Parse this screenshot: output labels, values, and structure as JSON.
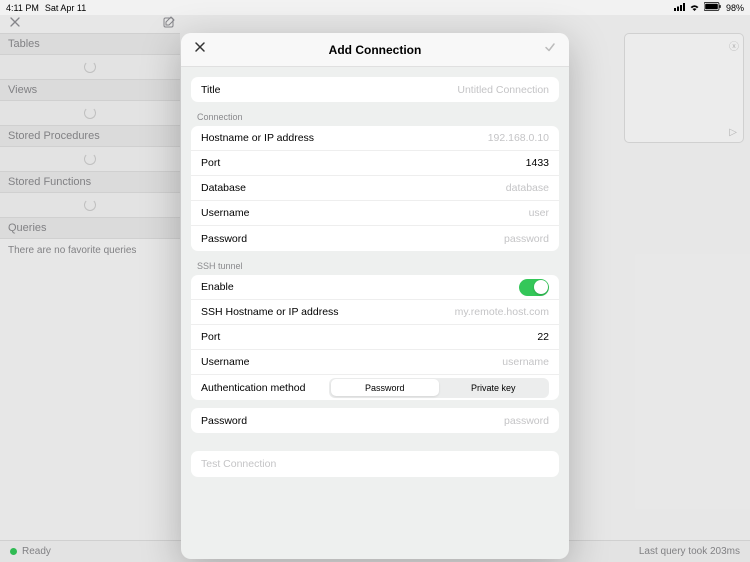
{
  "statusbar": {
    "time": "4:11 PM",
    "date": "Sat Apr 11",
    "battery": "98%"
  },
  "sidebar": {
    "sections": [
      "Tables",
      "Views",
      "Stored Procedures",
      "Stored Functions",
      "Queries"
    ],
    "queries_empty": "There are no favorite queries"
  },
  "bottombar": {
    "status": "Ready",
    "query_time": "Last query took 203ms"
  },
  "modal": {
    "title": "Add Connection",
    "title_field": {
      "label": "Title",
      "placeholder": "Untitled Connection"
    },
    "connection_section": "Connection",
    "hostname": {
      "label": "Hostname or IP address",
      "placeholder": "192.168.0.10"
    },
    "port": {
      "label": "Port",
      "value": "1433"
    },
    "database": {
      "label": "Database",
      "placeholder": "database"
    },
    "username": {
      "label": "Username",
      "placeholder": "user"
    },
    "password": {
      "label": "Password",
      "placeholder": "password"
    },
    "ssh_section": "SSH tunnel",
    "ssh_enable": {
      "label": "Enable"
    },
    "ssh_host": {
      "label": "SSH Hostname or IP address",
      "placeholder": "my.remote.host.com"
    },
    "ssh_port": {
      "label": "Port",
      "value": "22"
    },
    "ssh_username": {
      "label": "Username",
      "placeholder": "username"
    },
    "auth_method": {
      "label": "Authentication method",
      "options": [
        "Password",
        "Private key"
      ],
      "selected": 0
    },
    "ssh_password": {
      "label": "Password",
      "placeholder": "password"
    },
    "test": "Test Connection"
  }
}
